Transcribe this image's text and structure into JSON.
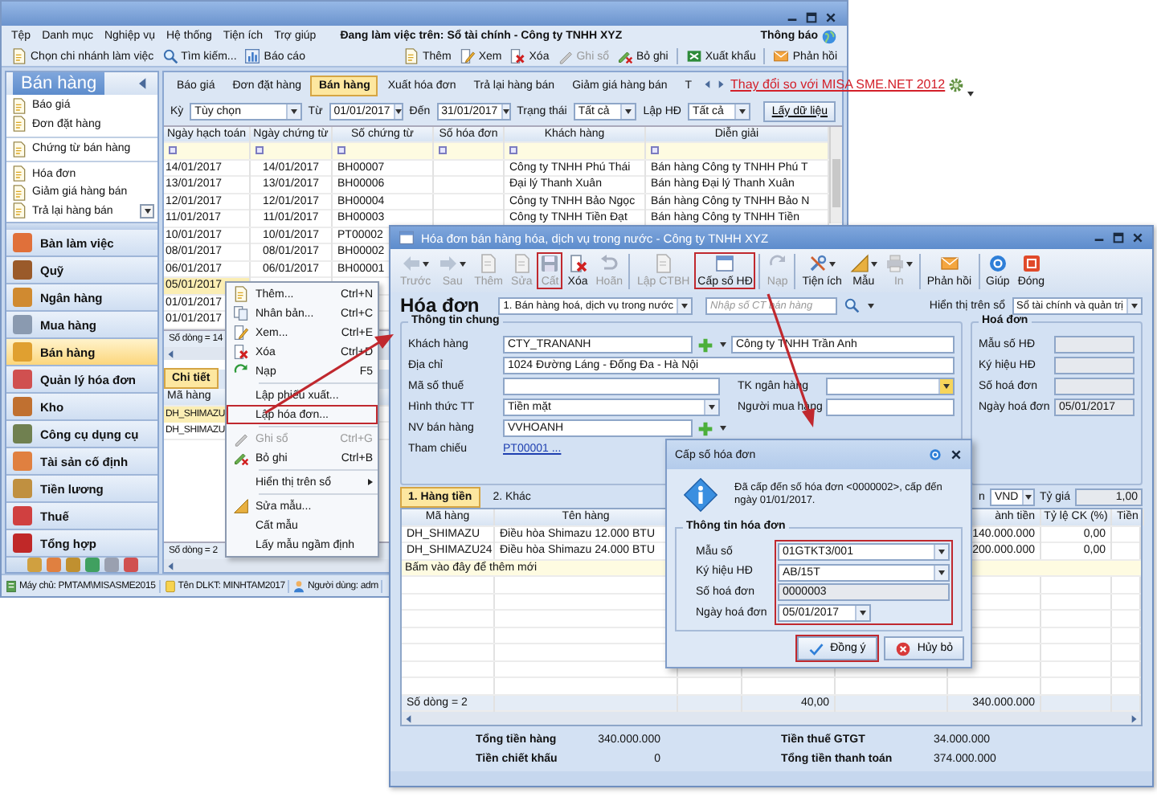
{
  "main_window": {
    "menu": [
      "Tệp",
      "Danh mục",
      "Nghiệp vụ",
      "Hệ thống",
      "Tiện ích",
      "Trợ giúp"
    ],
    "working_on": "Đang làm việc trên: Sổ tài chính - Công ty TNHH XYZ",
    "notifications": "Thông báo",
    "toolbar_left": [
      "Chọn chi nhánh làm việc",
      "Tìm kiếm...",
      "Báo cáo"
    ],
    "toolbar_right": [
      {
        "label": "Thêm",
        "disabled": false
      },
      {
        "label": "Xem",
        "disabled": false
      },
      {
        "label": "Xóa",
        "disabled": false
      },
      {
        "label": "Ghi sổ",
        "disabled": true
      },
      {
        "label": "Bỏ ghi",
        "disabled": false
      },
      {
        "label": "Xuất khẩu",
        "disabled": false
      },
      {
        "label": "Phản hồi",
        "disabled": false
      }
    ],
    "sidebar": {
      "title": "Bán hàng",
      "items": [
        "Báo giá",
        "Đơn đặt hàng",
        "Chứng từ bán hàng",
        "Hóa đơn",
        "Giảm giá hàng bán",
        "Trả lại hàng bán"
      ],
      "modules": [
        {
          "label": "Bàn làm việc",
          "selected": false
        },
        {
          "label": "Quỹ",
          "selected": false
        },
        {
          "label": "Ngân hàng",
          "selected": false
        },
        {
          "label": "Mua hàng",
          "selected": false
        },
        {
          "label": "Bán hàng",
          "selected": true
        },
        {
          "label": "Quản lý hóa đơn",
          "selected": false
        },
        {
          "label": "Kho",
          "selected": false
        },
        {
          "label": "Công cụ dụng cụ",
          "selected": false
        },
        {
          "label": "Tài sản cố định",
          "selected": false
        },
        {
          "label": "Tiền lương",
          "selected": false
        },
        {
          "label": "Thuế",
          "selected": false
        },
        {
          "label": "Tổng hợp",
          "selected": false
        }
      ]
    },
    "tabs": [
      {
        "label": "Báo giá",
        "selected": false
      },
      {
        "label": "Đơn đặt hàng",
        "selected": false
      },
      {
        "label": "Bán hàng",
        "selected": true
      },
      {
        "label": "Xuất hóa đơn",
        "selected": false
      },
      {
        "label": "Trả lại hàng bán",
        "selected": false
      },
      {
        "label": "Giảm giá hàng bán",
        "selected": false
      },
      {
        "label": "T",
        "selected": false
      }
    ],
    "link": "Thay đổi so với MISA SME.NET 2012",
    "filters": [
      {
        "label": "Kỳ",
        "value": "Tùy chọn"
      },
      {
        "label": "Từ",
        "value": "01/01/2017"
      },
      {
        "label": "Đến",
        "value": "31/01/2017"
      },
      {
        "label": "Trạng thái",
        "value": "Tất cả"
      },
      {
        "label": "Lập HĐ",
        "value": "Tất cả"
      }
    ],
    "fetch_button": "Lấy dữ liệu",
    "grid": {
      "columns": [
        "Ngày hạch toán",
        "Ngày chứng từ",
        "Số chứng từ",
        "Số hóa đơn",
        "Khách hàng",
        "Diễn giải"
      ],
      "rows": [
        {
          "cells": [
            "14/01/2017",
            "14/01/2017",
            "BH00007",
            null,
            "Công ty TNHH Phú Thái",
            "Bán hàng Công ty TNHH Phú T"
          ],
          "selected": false
        },
        {
          "cells": [
            "13/01/2017",
            "13/01/2017",
            "BH00006",
            null,
            "Đại lý Thanh Xuân",
            "Bán hàng Đại lý Thanh Xuân"
          ],
          "selected": false
        },
        {
          "cells": [
            "12/01/2017",
            "12/01/2017",
            "BH00004",
            null,
            "Công ty TNHH Bảo Ngọc",
            "Bán hàng Công ty TNHH Bảo N"
          ],
          "selected": false
        },
        {
          "cells": [
            "11/01/2017",
            "11/01/2017",
            "BH00003",
            null,
            "Công ty TNHH Tiền Đạt",
            "Bán hàng Công ty TNHH Tiền"
          ],
          "selected": false
        },
        {
          "cells": [
            "10/01/2017",
            "10/01/2017",
            "PT00002"
          ],
          "selected": false
        },
        {
          "cells": [
            "08/01/2017",
            "08/01/2017",
            "BH00002"
          ],
          "selected": false
        },
        {
          "cells": [
            "06/01/2017",
            "06/01/2017",
            "BH00001"
          ],
          "selected": false
        },
        {
          "cells": [
            "05/01/2017"
          ],
          "selected": true
        },
        {
          "cells": [
            "01/01/2017"
          ],
          "selected": false
        },
        {
          "cells": [
            "01/01/2017"
          ],
          "selected": false
        }
      ],
      "row_count": "Số dòng = 14"
    },
    "detail": {
      "tab": "Chi tiết",
      "column": "Mã hàng",
      "rows": [
        {
          "cells": [
            "DH_SHIMAZU"
          ],
          "selected": true
        },
        {
          "cells": [
            "DH_SHIMAZU"
          ],
          "selected": false
        }
      ],
      "row_count": "Số dòng = 2"
    },
    "status_bar": [
      "Máy chủ: PMTAM\\MISASME2015",
      "Tên DLKT: MINHTAM2017",
      "Người dùng: adm"
    ]
  },
  "context_menu": [
    {
      "label": "Thêm...",
      "shortcut": "Ctrl+N",
      "disabled": false,
      "outlined": false,
      "submenu": false
    },
    {
      "label": "Nhân bản...",
      "shortcut": "Ctrl+C",
      "disabled": false,
      "outlined": false,
      "submenu": false
    },
    {
      "label": "Xem...",
      "shortcut": "Ctrl+E",
      "disabled": false,
      "outlined": false,
      "submenu": false
    },
    {
      "label": "Xóa",
      "shortcut": "Ctrl+D",
      "disabled": false,
      "outlined": false,
      "submenu": false
    },
    {
      "label": "Nạp",
      "shortcut": "F5",
      "disabled": false,
      "outlined": false,
      "submenu": false
    },
    {
      "label": "Lập phiếu xuất...",
      "disabled": false,
      "outlined": false,
      "submenu": false
    },
    {
      "label": "Lập hóa đơn...",
      "disabled": false,
      "outlined": true,
      "submenu": false
    },
    {
      "label": "Ghi sổ",
      "shortcut": "Ctrl+G",
      "disabled": true,
      "outlined": false,
      "submenu": false
    },
    {
      "label": "Bỏ ghi",
      "shortcut": "Ctrl+B",
      "disabled": false,
      "outlined": false,
      "submenu": false
    },
    {
      "label": "Hiển thị trên sổ",
      "disabled": false,
      "outlined": false,
      "submenu": true
    },
    {
      "label": "Sửa mẫu...",
      "disabled": false,
      "outlined": false,
      "submenu": false
    },
    {
      "label": "Cất mẫu",
      "disabled": false,
      "outlined": false,
      "submenu": false
    },
    {
      "label": "Lấy mẫu ngầm định",
      "disabled": false,
      "outlined": false,
      "submenu": false
    }
  ],
  "invoice_window": {
    "title": "Hóa đơn bán hàng hóa, dịch vụ trong nước - Công ty TNHH XYZ",
    "toolbar": [
      {
        "label": "Trước",
        "disabled": true,
        "outlined": false,
        "dropdown": true
      },
      {
        "label": "Sau",
        "disabled": true,
        "outlined": false,
        "dropdown": true
      },
      {
        "label": "Thêm",
        "disabled": true,
        "outlined": false,
        "dropdown": false
      },
      {
        "label": "Sửa",
        "disabled": true,
        "outlined": false,
        "dropdown": false
      },
      {
        "label": "Cất",
        "disabled": true,
        "outlined": true,
        "dropdown": false
      },
      {
        "label": "Xóa",
        "disabled": false,
        "outlined": false,
        "dropdown": false
      },
      {
        "label": "Hoãn",
        "disabled": true,
        "outlined": false,
        "dropdown": false
      },
      {
        "label": "Lập CTBH",
        "disabled": true,
        "outlined": false,
        "dropdown": false
      },
      {
        "label": "Cấp số HĐ",
        "disabled": false,
        "outlined": true,
        "dropdown": false
      },
      {
        "label": "Nạp",
        "disabled": true,
        "outlined": false,
        "dropdown": false
      },
      {
        "label": "Tiện ích",
        "disabled": false,
        "outlined": false,
        "dropdown": true
      },
      {
        "label": "Mẫu",
        "disabled": false,
        "outlined": false,
        "dropdown": true
      },
      {
        "label": "In",
        "disabled": true,
        "outlined": false,
        "dropdown": true
      },
      {
        "label": "Phản hồi",
        "disabled": false,
        "outlined": false,
        "dropdown": false
      },
      {
        "label": "Giúp",
        "disabled": false,
        "outlined": false,
        "dropdown": false
      },
      {
        "label": "Đóng",
        "disabled": false,
        "outlined": false,
        "dropdown": false
      }
    ],
    "heading": "Hóa đơn",
    "type_select": "1. Bán hàng hoá, dịch vụ trong nước",
    "search_placeholder": "Nhập số CT bán hàng",
    "ledger_label": "Hiển thị trên sổ",
    "ledger_select": "Sổ tài chính và quản trị",
    "general": {
      "title": "Thông tin chung",
      "customer": {
        "label": "Khách hàng",
        "code": "CTY_TRANANH",
        "name": "Công ty TNHH Trần Anh"
      },
      "address": {
        "label": "Địa chỉ",
        "value": "1024 Đường Láng - Đống Đa - Hà Nội"
      },
      "tax_code": {
        "label": "Mã số thuế"
      },
      "bank_account": {
        "label": "TK ngân hàng"
      },
      "payment": {
        "label": "Hình thức TT",
        "value": "Tiền mặt"
      },
      "buyer": {
        "label": "Người mua hàng"
      },
      "salesperson": {
        "label": "NV bán hàng",
        "value": "VVHOANH"
      },
      "reference": {
        "label": "Tham chiếu",
        "link": "PT00001 ..."
      }
    },
    "invoice_panel": {
      "title": "Hoá đơn",
      "fields": [
        {
          "label": "Mẫu số HĐ"
        },
        {
          "label": "Ký hiệu HĐ"
        },
        {
          "label": "Số hoá đơn"
        },
        {
          "label": "Ngày hoá đơn",
          "value": "05/01/2017"
        }
      ]
    },
    "tabs": [
      {
        "label": "1. Hàng tiền",
        "selected": true
      },
      {
        "label": "2. Khác",
        "selected": false
      }
    ],
    "currency_label": "n",
    "currency": "VND",
    "rate_label": "Tỷ giá",
    "rate": "1,00",
    "grid": {
      "columns": {
        "code": "Mã hàng",
        "name": "Tên hàng",
        "amount": "ành tiền",
        "discount_rate": "Tỷ lệ CK (%)",
        "column_8": "Tiền"
      },
      "rows": [
        {
          "code": "DH_SHIMAZU",
          "name": "Điều hòa Shimazu 12.000 BTU",
          "amount": "140.000.000",
          "discount_rate": "0,00"
        },
        {
          "code": "DH_SHIMAZU24",
          "name": "Điều hòa Shimazu 24.000 BTU",
          "amount": "200.000.000",
          "discount_rate": "0,00"
        }
      ],
      "add_hint": "Bấm vào đây để thêm mới",
      "footer": {
        "count": "Số dòng = 2",
        "quantity": "40,00",
        "amount": "340.000.000"
      }
    },
    "totals": [
      {
        "label": "Tổng tiền hàng",
        "value": "340.000.000"
      },
      {
        "label": "Tiền chiết khấu",
        "value": "0"
      },
      {
        "label": "Tiền thuế GTGT",
        "value": "34.000.000"
      },
      {
        "label": "Tổng tiền thanh toán",
        "value": "374.000.000"
      }
    ]
  },
  "dialog": {
    "title": "Cấp số hóa đơn",
    "message": "Đã cấp đến số hóa đơn <0000002>, cấp đến ngày 01/01/2017.",
    "group_title": "Thông tin hóa đơn",
    "fields_outlined": true,
    "fields": [
      {
        "label": "Mẫu số",
        "value": "01GTKT3/001",
        "kind": "combo"
      },
      {
        "label": "Ký hiệu HĐ",
        "value": "AB/15T",
        "kind": "combo"
      },
      {
        "label": "Số hoá đơn",
        "value": "0000003",
        "kind": "readonly"
      },
      {
        "label": "Ngày hoá đơn",
        "value": "05/01/2017",
        "kind": "date"
      }
    ],
    "buttons": [
      {
        "label": "Đồng ý",
        "kind": "ok",
        "outlined": true
      },
      {
        "label": "Hủy bỏ",
        "kind": "cancel",
        "outlined": false
      }
    ]
  }
}
